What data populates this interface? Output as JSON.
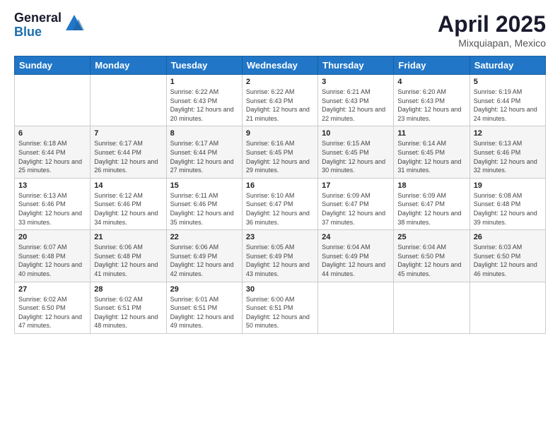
{
  "header": {
    "logo_general": "General",
    "logo_blue": "Blue",
    "title": "April 2025",
    "location": "Mixquiapan, Mexico"
  },
  "days_of_week": [
    "Sunday",
    "Monday",
    "Tuesday",
    "Wednesday",
    "Thursday",
    "Friday",
    "Saturday"
  ],
  "weeks": [
    [
      {
        "day": "",
        "info": ""
      },
      {
        "day": "",
        "info": ""
      },
      {
        "day": "1",
        "info": "Sunrise: 6:22 AM\nSunset: 6:43 PM\nDaylight: 12 hours and 20 minutes."
      },
      {
        "day": "2",
        "info": "Sunrise: 6:22 AM\nSunset: 6:43 PM\nDaylight: 12 hours and 21 minutes."
      },
      {
        "day": "3",
        "info": "Sunrise: 6:21 AM\nSunset: 6:43 PM\nDaylight: 12 hours and 22 minutes."
      },
      {
        "day": "4",
        "info": "Sunrise: 6:20 AM\nSunset: 6:43 PM\nDaylight: 12 hours and 23 minutes."
      },
      {
        "day": "5",
        "info": "Sunrise: 6:19 AM\nSunset: 6:44 PM\nDaylight: 12 hours and 24 minutes."
      }
    ],
    [
      {
        "day": "6",
        "info": "Sunrise: 6:18 AM\nSunset: 6:44 PM\nDaylight: 12 hours and 25 minutes."
      },
      {
        "day": "7",
        "info": "Sunrise: 6:17 AM\nSunset: 6:44 PM\nDaylight: 12 hours and 26 minutes."
      },
      {
        "day": "8",
        "info": "Sunrise: 6:17 AM\nSunset: 6:44 PM\nDaylight: 12 hours and 27 minutes."
      },
      {
        "day": "9",
        "info": "Sunrise: 6:16 AM\nSunset: 6:45 PM\nDaylight: 12 hours and 29 minutes."
      },
      {
        "day": "10",
        "info": "Sunrise: 6:15 AM\nSunset: 6:45 PM\nDaylight: 12 hours and 30 minutes."
      },
      {
        "day": "11",
        "info": "Sunrise: 6:14 AM\nSunset: 6:45 PM\nDaylight: 12 hours and 31 minutes."
      },
      {
        "day": "12",
        "info": "Sunrise: 6:13 AM\nSunset: 6:46 PM\nDaylight: 12 hours and 32 minutes."
      }
    ],
    [
      {
        "day": "13",
        "info": "Sunrise: 6:13 AM\nSunset: 6:46 PM\nDaylight: 12 hours and 33 minutes."
      },
      {
        "day": "14",
        "info": "Sunrise: 6:12 AM\nSunset: 6:46 PM\nDaylight: 12 hours and 34 minutes."
      },
      {
        "day": "15",
        "info": "Sunrise: 6:11 AM\nSunset: 6:46 PM\nDaylight: 12 hours and 35 minutes."
      },
      {
        "day": "16",
        "info": "Sunrise: 6:10 AM\nSunset: 6:47 PM\nDaylight: 12 hours and 36 minutes."
      },
      {
        "day": "17",
        "info": "Sunrise: 6:09 AM\nSunset: 6:47 PM\nDaylight: 12 hours and 37 minutes."
      },
      {
        "day": "18",
        "info": "Sunrise: 6:09 AM\nSunset: 6:47 PM\nDaylight: 12 hours and 38 minutes."
      },
      {
        "day": "19",
        "info": "Sunrise: 6:08 AM\nSunset: 6:48 PM\nDaylight: 12 hours and 39 minutes."
      }
    ],
    [
      {
        "day": "20",
        "info": "Sunrise: 6:07 AM\nSunset: 6:48 PM\nDaylight: 12 hours and 40 minutes."
      },
      {
        "day": "21",
        "info": "Sunrise: 6:06 AM\nSunset: 6:48 PM\nDaylight: 12 hours and 41 minutes."
      },
      {
        "day": "22",
        "info": "Sunrise: 6:06 AM\nSunset: 6:49 PM\nDaylight: 12 hours and 42 minutes."
      },
      {
        "day": "23",
        "info": "Sunrise: 6:05 AM\nSunset: 6:49 PM\nDaylight: 12 hours and 43 minutes."
      },
      {
        "day": "24",
        "info": "Sunrise: 6:04 AM\nSunset: 6:49 PM\nDaylight: 12 hours and 44 minutes."
      },
      {
        "day": "25",
        "info": "Sunrise: 6:04 AM\nSunset: 6:50 PM\nDaylight: 12 hours and 45 minutes."
      },
      {
        "day": "26",
        "info": "Sunrise: 6:03 AM\nSunset: 6:50 PM\nDaylight: 12 hours and 46 minutes."
      }
    ],
    [
      {
        "day": "27",
        "info": "Sunrise: 6:02 AM\nSunset: 6:50 PM\nDaylight: 12 hours and 47 minutes."
      },
      {
        "day": "28",
        "info": "Sunrise: 6:02 AM\nSunset: 6:51 PM\nDaylight: 12 hours and 48 minutes."
      },
      {
        "day": "29",
        "info": "Sunrise: 6:01 AM\nSunset: 6:51 PM\nDaylight: 12 hours and 49 minutes."
      },
      {
        "day": "30",
        "info": "Sunrise: 6:00 AM\nSunset: 6:51 PM\nDaylight: 12 hours and 50 minutes."
      },
      {
        "day": "",
        "info": ""
      },
      {
        "day": "",
        "info": ""
      },
      {
        "day": "",
        "info": ""
      }
    ]
  ]
}
